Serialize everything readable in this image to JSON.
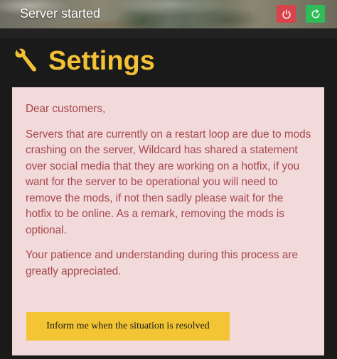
{
  "header": {
    "status_text": "Server started",
    "power_button": {
      "icon": "power-icon",
      "color": "#d9434a"
    },
    "restart_button": {
      "icon": "restart-icon",
      "color": "#2ebd59"
    }
  },
  "page": {
    "title_icon": "wrench-icon",
    "title": "Settings",
    "accent_color": "#f2c135"
  },
  "notice": {
    "greeting": "Dear customers,",
    "body": "Servers that are currently on a restart loop are due to mods crashing on the server, Wildcard has shared a statement over social media that they are working on a hotfix, if you want for the server to be operational you will need to remove the mods, if not then sadly please wait for the hotfix to be online. As a remark, removing the mods is optional.",
    "closing": "Your patience and understanding during this process are greatly appreciated.",
    "button_label": "Inform me when the situation is resolved",
    "background_color": "#f2d9da",
    "text_color": "#a5484d"
  }
}
